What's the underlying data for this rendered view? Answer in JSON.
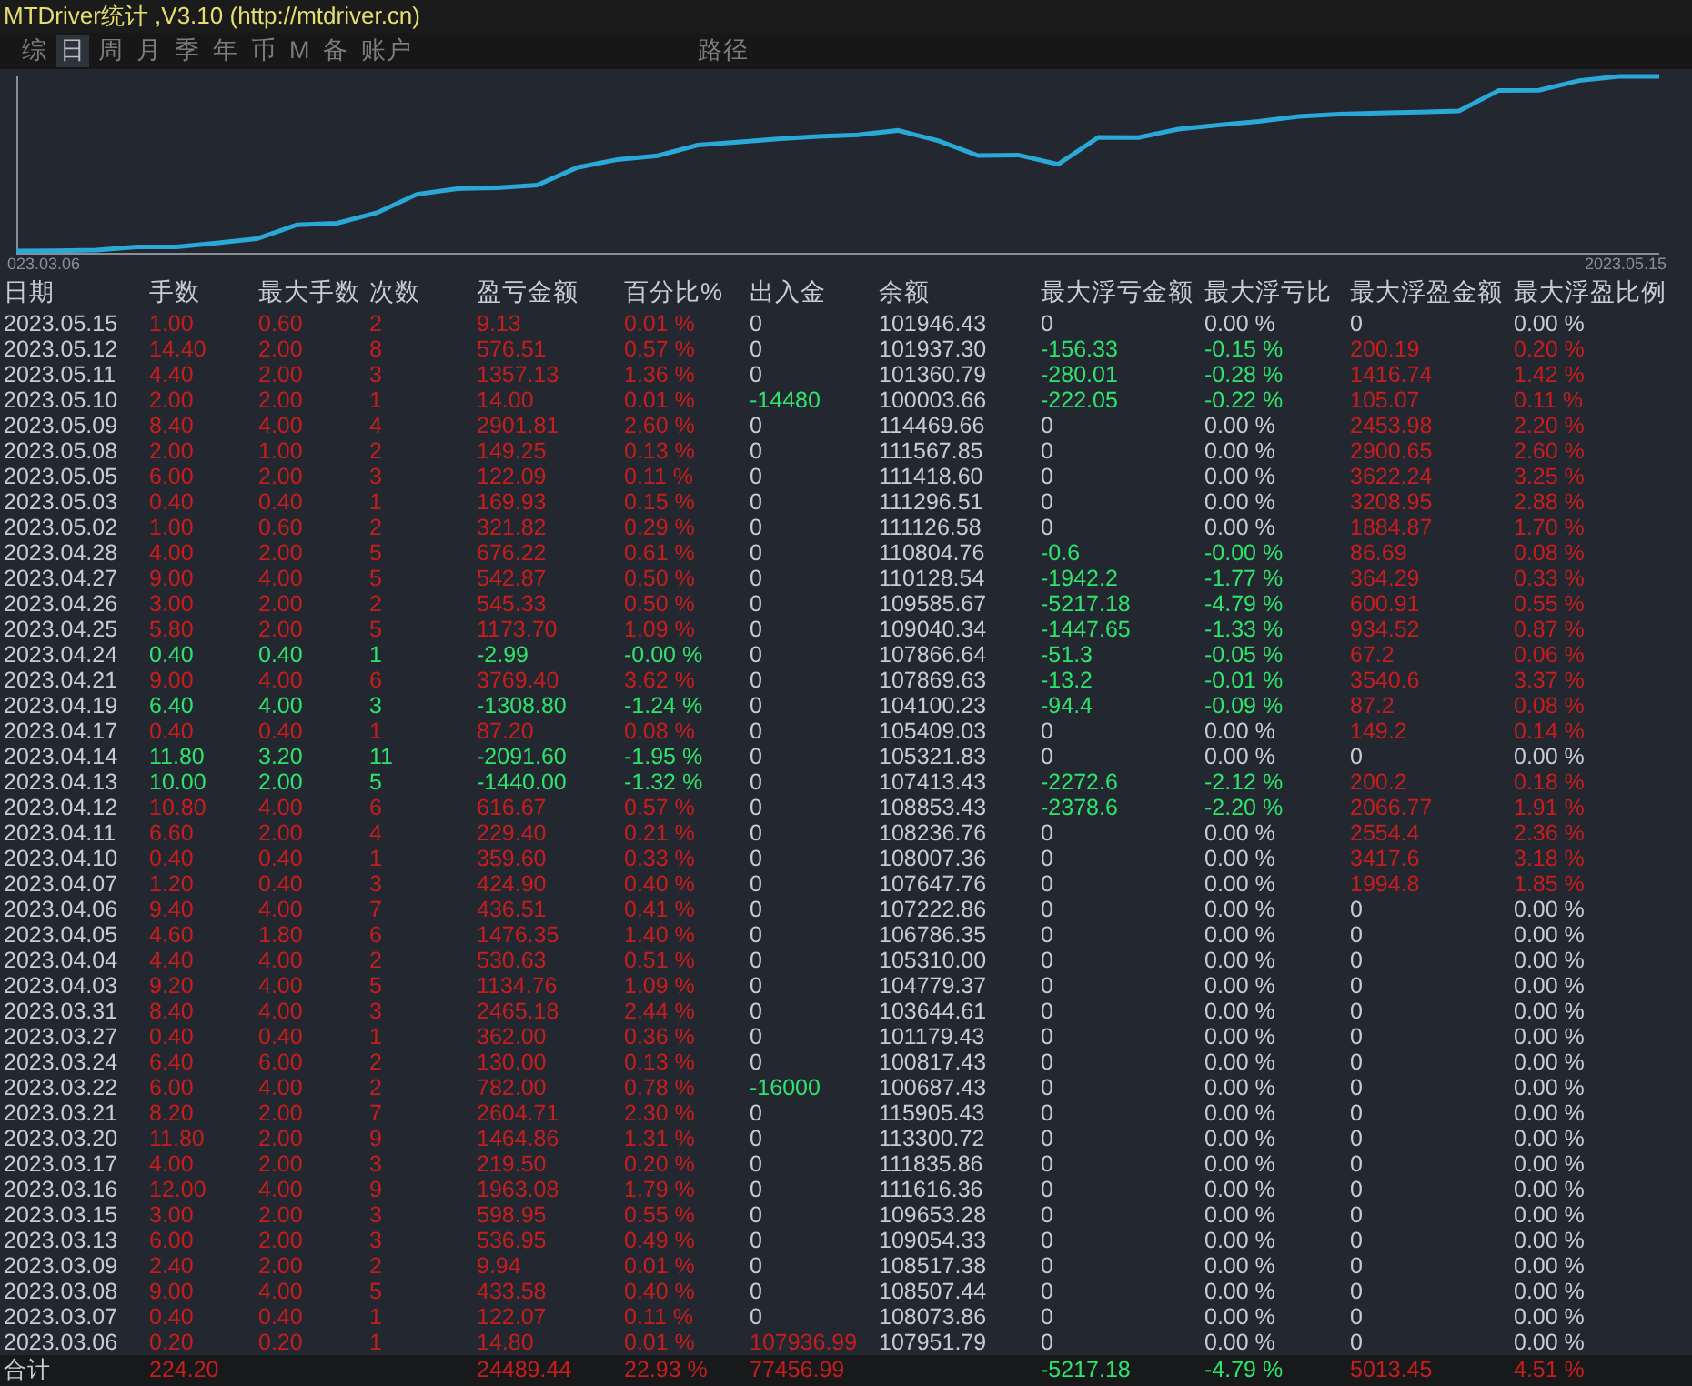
{
  "window": {
    "title": "MTDriver统计 ,V3.10 (http://mtdriver.cn)"
  },
  "tabs": [
    {
      "label": "综",
      "selected": false
    },
    {
      "label": "日",
      "selected": true
    },
    {
      "label": "周",
      "selected": false
    },
    {
      "label": "月",
      "selected": false
    },
    {
      "label": "季",
      "selected": false
    },
    {
      "label": "年",
      "selected": false
    },
    {
      "label": "币",
      "selected": false
    },
    {
      "label": "M",
      "selected": false
    },
    {
      "label": "备",
      "selected": false
    },
    {
      "label": "账户",
      "selected": false
    }
  ],
  "path_tab": {
    "label": "路径"
  },
  "chart": {
    "start_label": "023.03.06",
    "end_label": "2023.05.15"
  },
  "table": {
    "columns": [
      "日期",
      "手数",
      "最大手数",
      "次数",
      "盈亏金额",
      "百分比%",
      "出入金",
      "余额",
      "最大浮亏金额",
      "最大浮亏比",
      "最大浮盈金额",
      "最大浮盈比例"
    ],
    "rows": [
      {
        "date": "2023.05.15",
        "trade": {
          "cells": [
            "1.00",
            "0.60",
            "2",
            "9.13",
            "0.01 %"
          ],
          "color": "#c81d1d"
        },
        "cash": {
          "text": "0",
          "color": "#c8ccd4"
        },
        "balance": "101946.43",
        "max_loss": {
          "cells": [
            "0",
            "0.00 %"
          ],
          "color": "#c8ccd4"
        },
        "max_gain": {
          "cells": [
            "0",
            "0.00 %"
          ],
          "color": "#c8ccd4"
        }
      },
      {
        "date": "2023.05.12",
        "trade": {
          "cells": [
            "14.40",
            "2.00",
            "8",
            "576.51",
            "0.57 %"
          ],
          "color": "#c81d1d"
        },
        "cash": {
          "text": "0",
          "color": "#c8ccd4"
        },
        "balance": "101937.30",
        "max_loss": {
          "cells": [
            "-156.33",
            "-0.15 %"
          ],
          "color": "#2ee36c"
        },
        "max_gain": {
          "cells": [
            "200.19",
            "0.20 %"
          ],
          "color": "#c81d1d"
        }
      },
      {
        "date": "2023.05.11",
        "trade": {
          "cells": [
            "4.40",
            "2.00",
            "3",
            "1357.13",
            "1.36 %"
          ],
          "color": "#c81d1d"
        },
        "cash": {
          "text": "0",
          "color": "#c8ccd4"
        },
        "balance": "101360.79",
        "max_loss": {
          "cells": [
            "-280.01",
            "-0.28 %"
          ],
          "color": "#2ee36c"
        },
        "max_gain": {
          "cells": [
            "1416.74",
            "1.42 %"
          ],
          "color": "#c81d1d"
        }
      },
      {
        "date": "2023.05.10",
        "trade": {
          "cells": [
            "2.00",
            "2.00",
            "1",
            "14.00",
            "0.01 %"
          ],
          "color": "#c81d1d"
        },
        "cash": {
          "text": "-14480",
          "color": "#2ee36c"
        },
        "balance": "100003.66",
        "max_loss": {
          "cells": [
            "-222.05",
            "-0.22 %"
          ],
          "color": "#2ee36c"
        },
        "max_gain": {
          "cells": [
            "105.07",
            "0.11 %"
          ],
          "color": "#c81d1d"
        }
      },
      {
        "date": "2023.05.09",
        "trade": {
          "cells": [
            "8.40",
            "4.00",
            "4",
            "2901.81",
            "2.60 %"
          ],
          "color": "#c81d1d"
        },
        "cash": {
          "text": "0",
          "color": "#c8ccd4"
        },
        "balance": "114469.66",
        "max_loss": {
          "cells": [
            "0",
            "0.00 %"
          ],
          "color": "#c8ccd4"
        },
        "max_gain": {
          "cells": [
            "2453.98",
            "2.20 %"
          ],
          "color": "#c81d1d"
        }
      },
      {
        "date": "2023.05.08",
        "trade": {
          "cells": [
            "2.00",
            "1.00",
            "2",
            "149.25",
            "0.13 %"
          ],
          "color": "#c81d1d"
        },
        "cash": {
          "text": "0",
          "color": "#c8ccd4"
        },
        "balance": "111567.85",
        "max_loss": {
          "cells": [
            "0",
            "0.00 %"
          ],
          "color": "#c8ccd4"
        },
        "max_gain": {
          "cells": [
            "2900.65",
            "2.60 %"
          ],
          "color": "#c81d1d"
        }
      },
      {
        "date": "2023.05.05",
        "trade": {
          "cells": [
            "6.00",
            "2.00",
            "3",
            "122.09",
            "0.11 %"
          ],
          "color": "#c81d1d"
        },
        "cash": {
          "text": "0",
          "color": "#c8ccd4"
        },
        "balance": "111418.60",
        "max_loss": {
          "cells": [
            "0",
            "0.00 %"
          ],
          "color": "#c8ccd4"
        },
        "max_gain": {
          "cells": [
            "3622.24",
            "3.25 %"
          ],
          "color": "#c81d1d"
        }
      },
      {
        "date": "2023.05.03",
        "trade": {
          "cells": [
            "0.40",
            "0.40",
            "1",
            "169.93",
            "0.15 %"
          ],
          "color": "#c81d1d"
        },
        "cash": {
          "text": "0",
          "color": "#c8ccd4"
        },
        "balance": "111296.51",
        "max_loss": {
          "cells": [
            "0",
            "0.00 %"
          ],
          "color": "#c8ccd4"
        },
        "max_gain": {
          "cells": [
            "3208.95",
            "2.88 %"
          ],
          "color": "#c81d1d"
        }
      },
      {
        "date": "2023.05.02",
        "trade": {
          "cells": [
            "1.00",
            "0.60",
            "2",
            "321.82",
            "0.29 %"
          ],
          "color": "#c81d1d"
        },
        "cash": {
          "text": "0",
          "color": "#c8ccd4"
        },
        "balance": "111126.58",
        "max_loss": {
          "cells": [
            "0",
            "0.00 %"
          ],
          "color": "#c8ccd4"
        },
        "max_gain": {
          "cells": [
            "1884.87",
            "1.70 %"
          ],
          "color": "#c81d1d"
        }
      },
      {
        "date": "2023.04.28",
        "trade": {
          "cells": [
            "4.00",
            "2.00",
            "5",
            "676.22",
            "0.61 %"
          ],
          "color": "#c81d1d"
        },
        "cash": {
          "text": "0",
          "color": "#c8ccd4"
        },
        "balance": "110804.76",
        "max_loss": {
          "cells": [
            "-0.6",
            "-0.00 %"
          ],
          "color": "#2ee36c"
        },
        "max_gain": {
          "cells": [
            "86.69",
            "0.08 %"
          ],
          "color": "#c81d1d"
        }
      },
      {
        "date": "2023.04.27",
        "trade": {
          "cells": [
            "9.00",
            "4.00",
            "5",
            "542.87",
            "0.50 %"
          ],
          "color": "#c81d1d"
        },
        "cash": {
          "text": "0",
          "color": "#c8ccd4"
        },
        "balance": "110128.54",
        "max_loss": {
          "cells": [
            "-1942.2",
            "-1.77 %"
          ],
          "color": "#2ee36c"
        },
        "max_gain": {
          "cells": [
            "364.29",
            "0.33 %"
          ],
          "color": "#c81d1d"
        }
      },
      {
        "date": "2023.04.26",
        "trade": {
          "cells": [
            "3.00",
            "2.00",
            "2",
            "545.33",
            "0.50 %"
          ],
          "color": "#c81d1d"
        },
        "cash": {
          "text": "0",
          "color": "#c8ccd4"
        },
        "balance": "109585.67",
        "max_loss": {
          "cells": [
            "-5217.18",
            "-4.79 %"
          ],
          "color": "#2ee36c"
        },
        "max_gain": {
          "cells": [
            "600.91",
            "0.55 %"
          ],
          "color": "#c81d1d"
        }
      },
      {
        "date": "2023.04.25",
        "trade": {
          "cells": [
            "5.80",
            "2.00",
            "5",
            "1173.70",
            "1.09 %"
          ],
          "color": "#c81d1d"
        },
        "cash": {
          "text": "0",
          "color": "#c8ccd4"
        },
        "balance": "109040.34",
        "max_loss": {
          "cells": [
            "-1447.65",
            "-1.33 %"
          ],
          "color": "#2ee36c"
        },
        "max_gain": {
          "cells": [
            "934.52",
            "0.87 %"
          ],
          "color": "#c81d1d"
        }
      },
      {
        "date": "2023.04.24",
        "trade": {
          "cells": [
            "0.40",
            "0.40",
            "1",
            "-2.99",
            "-0.00 %"
          ],
          "color": "#2ee36c"
        },
        "cash": {
          "text": "0",
          "color": "#c8ccd4"
        },
        "balance": "107866.64",
        "max_loss": {
          "cells": [
            "-51.3",
            "-0.05 %"
          ],
          "color": "#2ee36c"
        },
        "max_gain": {
          "cells": [
            "67.2",
            "0.06 %"
          ],
          "color": "#c81d1d"
        }
      },
      {
        "date": "2023.04.21",
        "trade": {
          "cells": [
            "9.00",
            "4.00",
            "6",
            "3769.40",
            "3.62 %"
          ],
          "color": "#c81d1d"
        },
        "cash": {
          "text": "0",
          "color": "#c8ccd4"
        },
        "balance": "107869.63",
        "max_loss": {
          "cells": [
            "-13.2",
            "-0.01 %"
          ],
          "color": "#2ee36c"
        },
        "max_gain": {
          "cells": [
            "3540.6",
            "3.37 %"
          ],
          "color": "#c81d1d"
        }
      },
      {
        "date": "2023.04.19",
        "trade": {
          "cells": [
            "6.40",
            "4.00",
            "3",
            "-1308.80",
            "-1.24 %"
          ],
          "color": "#2ee36c"
        },
        "cash": {
          "text": "0",
          "color": "#c8ccd4"
        },
        "balance": "104100.23",
        "max_loss": {
          "cells": [
            "-94.4",
            "-0.09 %"
          ],
          "color": "#2ee36c"
        },
        "max_gain": {
          "cells": [
            "87.2",
            "0.08 %"
          ],
          "color": "#c81d1d"
        }
      },
      {
        "date": "2023.04.17",
        "trade": {
          "cells": [
            "0.40",
            "0.40",
            "1",
            "87.20",
            "0.08 %"
          ],
          "color": "#c81d1d"
        },
        "cash": {
          "text": "0",
          "color": "#c8ccd4"
        },
        "balance": "105409.03",
        "max_loss": {
          "cells": [
            "0",
            "0.00 %"
          ],
          "color": "#c8ccd4"
        },
        "max_gain": {
          "cells": [
            "149.2",
            "0.14 %"
          ],
          "color": "#c81d1d"
        }
      },
      {
        "date": "2023.04.14",
        "trade": {
          "cells": [
            "11.80",
            "3.20",
            "11",
            "-2091.60",
            "-1.95 %"
          ],
          "color": "#2ee36c"
        },
        "cash": {
          "text": "0",
          "color": "#c8ccd4"
        },
        "balance": "105321.83",
        "max_loss": {
          "cells": [
            "0",
            "0.00 %"
          ],
          "color": "#c8ccd4"
        },
        "max_gain": {
          "cells": [
            "0",
            "0.00 %"
          ],
          "color": "#c8ccd4"
        }
      },
      {
        "date": "2023.04.13",
        "trade": {
          "cells": [
            "10.00",
            "2.00",
            "5",
            "-1440.00",
            "-1.32 %"
          ],
          "color": "#2ee36c"
        },
        "cash": {
          "text": "0",
          "color": "#c8ccd4"
        },
        "balance": "107413.43",
        "max_loss": {
          "cells": [
            "-2272.6",
            "-2.12 %"
          ],
          "color": "#2ee36c"
        },
        "max_gain": {
          "cells": [
            "200.2",
            "0.18 %"
          ],
          "color": "#c81d1d"
        }
      },
      {
        "date": "2023.04.12",
        "trade": {
          "cells": [
            "10.80",
            "4.00",
            "6",
            "616.67",
            "0.57 %"
          ],
          "color": "#c81d1d"
        },
        "cash": {
          "text": "0",
          "color": "#c8ccd4"
        },
        "balance": "108853.43",
        "max_loss": {
          "cells": [
            "-2378.6",
            "-2.20 %"
          ],
          "color": "#2ee36c"
        },
        "max_gain": {
          "cells": [
            "2066.77",
            "1.91 %"
          ],
          "color": "#c81d1d"
        }
      },
      {
        "date": "2023.04.11",
        "trade": {
          "cells": [
            "6.60",
            "2.00",
            "4",
            "229.40",
            "0.21 %"
          ],
          "color": "#c81d1d"
        },
        "cash": {
          "text": "0",
          "color": "#c8ccd4"
        },
        "balance": "108236.76",
        "max_loss": {
          "cells": [
            "0",
            "0.00 %"
          ],
          "color": "#c8ccd4"
        },
        "max_gain": {
          "cells": [
            "2554.4",
            "2.36 %"
          ],
          "color": "#c81d1d"
        }
      },
      {
        "date": "2023.04.10",
        "trade": {
          "cells": [
            "0.40",
            "0.40",
            "1",
            "359.60",
            "0.33 %"
          ],
          "color": "#c81d1d"
        },
        "cash": {
          "text": "0",
          "color": "#c8ccd4"
        },
        "balance": "108007.36",
        "max_loss": {
          "cells": [
            "0",
            "0.00 %"
          ],
          "color": "#c8ccd4"
        },
        "max_gain": {
          "cells": [
            "3417.6",
            "3.18 %"
          ],
          "color": "#c81d1d"
        }
      },
      {
        "date": "2023.04.07",
        "trade": {
          "cells": [
            "1.20",
            "0.40",
            "3",
            "424.90",
            "0.40 %"
          ],
          "color": "#c81d1d"
        },
        "cash": {
          "text": "0",
          "color": "#c8ccd4"
        },
        "balance": "107647.76",
        "max_loss": {
          "cells": [
            "0",
            "0.00 %"
          ],
          "color": "#c8ccd4"
        },
        "max_gain": {
          "cells": [
            "1994.8",
            "1.85 %"
          ],
          "color": "#c81d1d"
        }
      },
      {
        "date": "2023.04.06",
        "trade": {
          "cells": [
            "9.40",
            "4.00",
            "7",
            "436.51",
            "0.41 %"
          ],
          "color": "#c81d1d"
        },
        "cash": {
          "text": "0",
          "color": "#c8ccd4"
        },
        "balance": "107222.86",
        "max_loss": {
          "cells": [
            "0",
            "0.00 %"
          ],
          "color": "#c8ccd4"
        },
        "max_gain": {
          "cells": [
            "0",
            "0.00 %"
          ],
          "color": "#c8ccd4"
        }
      },
      {
        "date": "2023.04.05",
        "trade": {
          "cells": [
            "4.60",
            "1.80",
            "6",
            "1476.35",
            "1.40 %"
          ],
          "color": "#c81d1d"
        },
        "cash": {
          "text": "0",
          "color": "#c8ccd4"
        },
        "balance": "106786.35",
        "max_loss": {
          "cells": [
            "0",
            "0.00 %"
          ],
          "color": "#c8ccd4"
        },
        "max_gain": {
          "cells": [
            "0",
            "0.00 %"
          ],
          "color": "#c8ccd4"
        }
      },
      {
        "date": "2023.04.04",
        "trade": {
          "cells": [
            "4.40",
            "4.00",
            "2",
            "530.63",
            "0.51 %"
          ],
          "color": "#c81d1d"
        },
        "cash": {
          "text": "0",
          "color": "#c8ccd4"
        },
        "balance": "105310.00",
        "max_loss": {
          "cells": [
            "0",
            "0.00 %"
          ],
          "color": "#c8ccd4"
        },
        "max_gain": {
          "cells": [
            "0",
            "0.00 %"
          ],
          "color": "#c8ccd4"
        }
      },
      {
        "date": "2023.04.03",
        "trade": {
          "cells": [
            "9.20",
            "4.00",
            "5",
            "1134.76",
            "1.09 %"
          ],
          "color": "#c81d1d"
        },
        "cash": {
          "text": "0",
          "color": "#c8ccd4"
        },
        "balance": "104779.37",
        "max_loss": {
          "cells": [
            "0",
            "0.00 %"
          ],
          "color": "#c8ccd4"
        },
        "max_gain": {
          "cells": [
            "0",
            "0.00 %"
          ],
          "color": "#c8ccd4"
        }
      },
      {
        "date": "2023.03.31",
        "trade": {
          "cells": [
            "8.40",
            "4.00",
            "3",
            "2465.18",
            "2.44 %"
          ],
          "color": "#c81d1d"
        },
        "cash": {
          "text": "0",
          "color": "#c8ccd4"
        },
        "balance": "103644.61",
        "max_loss": {
          "cells": [
            "0",
            "0.00 %"
          ],
          "color": "#c8ccd4"
        },
        "max_gain": {
          "cells": [
            "0",
            "0.00 %"
          ],
          "color": "#c8ccd4"
        }
      },
      {
        "date": "2023.03.27",
        "trade": {
          "cells": [
            "0.40",
            "0.40",
            "1",
            "362.00",
            "0.36 %"
          ],
          "color": "#c81d1d"
        },
        "cash": {
          "text": "0",
          "color": "#c8ccd4"
        },
        "balance": "101179.43",
        "max_loss": {
          "cells": [
            "0",
            "0.00 %"
          ],
          "color": "#c8ccd4"
        },
        "max_gain": {
          "cells": [
            "0",
            "0.00 %"
          ],
          "color": "#c8ccd4"
        }
      },
      {
        "date": "2023.03.24",
        "trade": {
          "cells": [
            "6.40",
            "6.00",
            "2",
            "130.00",
            "0.13 %"
          ],
          "color": "#c81d1d"
        },
        "cash": {
          "text": "0",
          "color": "#c8ccd4"
        },
        "balance": "100817.43",
        "max_loss": {
          "cells": [
            "0",
            "0.00 %"
          ],
          "color": "#c8ccd4"
        },
        "max_gain": {
          "cells": [
            "0",
            "0.00 %"
          ],
          "color": "#c8ccd4"
        }
      },
      {
        "date": "2023.03.22",
        "trade": {
          "cells": [
            "6.00",
            "4.00",
            "2",
            "782.00",
            "0.78 %"
          ],
          "color": "#c81d1d"
        },
        "cash": {
          "text": "-16000",
          "color": "#2ee36c"
        },
        "balance": "100687.43",
        "max_loss": {
          "cells": [
            "0",
            "0.00 %"
          ],
          "color": "#c8ccd4"
        },
        "max_gain": {
          "cells": [
            "0",
            "0.00 %"
          ],
          "color": "#c8ccd4"
        }
      },
      {
        "date": "2023.03.21",
        "trade": {
          "cells": [
            "8.20",
            "2.00",
            "7",
            "2604.71",
            "2.30 %"
          ],
          "color": "#c81d1d"
        },
        "cash": {
          "text": "0",
          "color": "#c8ccd4"
        },
        "balance": "115905.43",
        "max_loss": {
          "cells": [
            "0",
            "0.00 %"
          ],
          "color": "#c8ccd4"
        },
        "max_gain": {
          "cells": [
            "0",
            "0.00 %"
          ],
          "color": "#c8ccd4"
        }
      },
      {
        "date": "2023.03.20",
        "trade": {
          "cells": [
            "11.80",
            "2.00",
            "9",
            "1464.86",
            "1.31 %"
          ],
          "color": "#c81d1d"
        },
        "cash": {
          "text": "0",
          "color": "#c8ccd4"
        },
        "balance": "113300.72",
        "max_loss": {
          "cells": [
            "0",
            "0.00 %"
          ],
          "color": "#c8ccd4"
        },
        "max_gain": {
          "cells": [
            "0",
            "0.00 %"
          ],
          "color": "#c8ccd4"
        }
      },
      {
        "date": "2023.03.17",
        "trade": {
          "cells": [
            "4.00",
            "2.00",
            "3",
            "219.50",
            "0.20 %"
          ],
          "color": "#c81d1d"
        },
        "cash": {
          "text": "0",
          "color": "#c8ccd4"
        },
        "balance": "111835.86",
        "max_loss": {
          "cells": [
            "0",
            "0.00 %"
          ],
          "color": "#c8ccd4"
        },
        "max_gain": {
          "cells": [
            "0",
            "0.00 %"
          ],
          "color": "#c8ccd4"
        }
      },
      {
        "date": "2023.03.16",
        "trade": {
          "cells": [
            "12.00",
            "4.00",
            "9",
            "1963.08",
            "1.79 %"
          ],
          "color": "#c81d1d"
        },
        "cash": {
          "text": "0",
          "color": "#c8ccd4"
        },
        "balance": "111616.36",
        "max_loss": {
          "cells": [
            "0",
            "0.00 %"
          ],
          "color": "#c8ccd4"
        },
        "max_gain": {
          "cells": [
            "0",
            "0.00 %"
          ],
          "color": "#c8ccd4"
        }
      },
      {
        "date": "2023.03.15",
        "trade": {
          "cells": [
            "3.00",
            "2.00",
            "3",
            "598.95",
            "0.55 %"
          ],
          "color": "#c81d1d"
        },
        "cash": {
          "text": "0",
          "color": "#c8ccd4"
        },
        "balance": "109653.28",
        "max_loss": {
          "cells": [
            "0",
            "0.00 %"
          ],
          "color": "#c8ccd4"
        },
        "max_gain": {
          "cells": [
            "0",
            "0.00 %"
          ],
          "color": "#c8ccd4"
        }
      },
      {
        "date": "2023.03.13",
        "trade": {
          "cells": [
            "6.00",
            "2.00",
            "3",
            "536.95",
            "0.49 %"
          ],
          "color": "#c81d1d"
        },
        "cash": {
          "text": "0",
          "color": "#c8ccd4"
        },
        "balance": "109054.33",
        "max_loss": {
          "cells": [
            "0",
            "0.00 %"
          ],
          "color": "#c8ccd4"
        },
        "max_gain": {
          "cells": [
            "0",
            "0.00 %"
          ],
          "color": "#c8ccd4"
        }
      },
      {
        "date": "2023.03.09",
        "trade": {
          "cells": [
            "2.40",
            "2.00",
            "2",
            "9.94",
            "0.01 %"
          ],
          "color": "#c81d1d"
        },
        "cash": {
          "text": "0",
          "color": "#c8ccd4"
        },
        "balance": "108517.38",
        "max_loss": {
          "cells": [
            "0",
            "0.00 %"
          ],
          "color": "#c8ccd4"
        },
        "max_gain": {
          "cells": [
            "0",
            "0.00 %"
          ],
          "color": "#c8ccd4"
        }
      },
      {
        "date": "2023.03.08",
        "trade": {
          "cells": [
            "9.00",
            "4.00",
            "5",
            "433.58",
            "0.40 %"
          ],
          "color": "#c81d1d"
        },
        "cash": {
          "text": "0",
          "color": "#c8ccd4"
        },
        "balance": "108507.44",
        "max_loss": {
          "cells": [
            "0",
            "0.00 %"
          ],
          "color": "#c8ccd4"
        },
        "max_gain": {
          "cells": [
            "0",
            "0.00 %"
          ],
          "color": "#c8ccd4"
        }
      },
      {
        "date": "2023.03.07",
        "trade": {
          "cells": [
            "0.40",
            "0.40",
            "1",
            "122.07",
            "0.11 %"
          ],
          "color": "#c81d1d"
        },
        "cash": {
          "text": "0",
          "color": "#c8ccd4"
        },
        "balance": "108073.86",
        "max_loss": {
          "cells": [
            "0",
            "0.00 %"
          ],
          "color": "#c8ccd4"
        },
        "max_gain": {
          "cells": [
            "0",
            "0.00 %"
          ],
          "color": "#c8ccd4"
        }
      },
      {
        "date": "2023.03.06",
        "trade": {
          "cells": [
            "0.20",
            "0.20",
            "1",
            "14.80",
            "0.01 %"
          ],
          "color": "#c81d1d"
        },
        "cash": {
          "text": "107936.99",
          "color": "#c81d1d"
        },
        "balance": "107951.79",
        "max_loss": {
          "cells": [
            "0",
            "0.00 %"
          ],
          "color": "#c8ccd4"
        },
        "max_gain": {
          "cells": [
            "0",
            "0.00 %"
          ],
          "color": "#c8ccd4"
        }
      }
    ],
    "total": {
      "label": "合计",
      "lots": {
        "text": "224.20",
        "color": "#c81d1d"
      },
      "profit": {
        "cells": [
          "24489.44",
          "22.93 %"
        ],
        "color": "#c81d1d"
      },
      "cash": {
        "text": "77456.99",
        "color": "#c81d1d"
      },
      "max_loss": {
        "cells": [
          "-5217.18",
          "-4.79 %"
        ],
        "color": "#2ee36c"
      },
      "max_gain": {
        "cells": [
          "5013.45",
          "4.51 %"
        ],
        "color": "#c81d1d"
      }
    }
  }
}
